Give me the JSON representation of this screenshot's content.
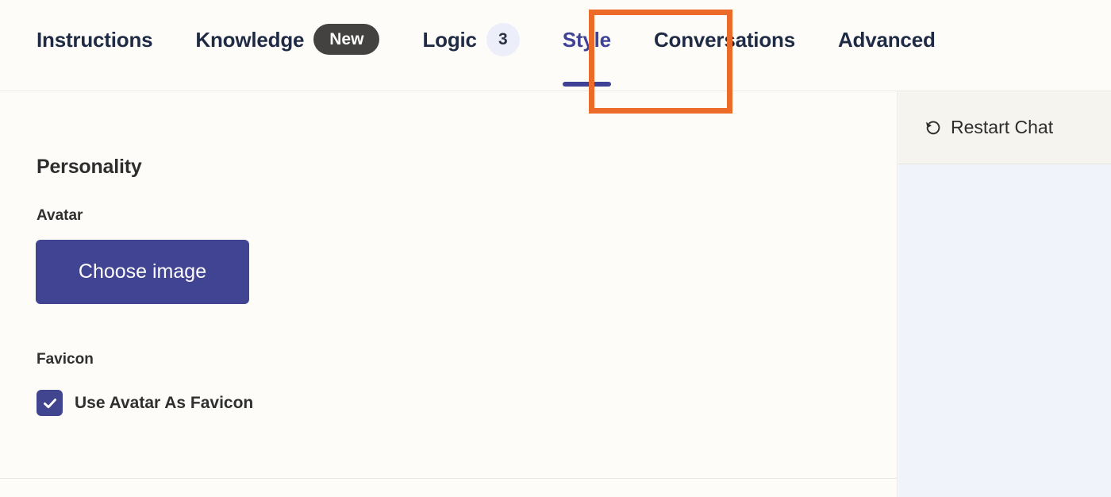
{
  "tabs": [
    {
      "label": "Instructions",
      "active": false,
      "badge": null,
      "badge_type": null
    },
    {
      "label": "Knowledge",
      "active": false,
      "badge": "New",
      "badge_type": "new"
    },
    {
      "label": "Logic",
      "active": false,
      "badge": "3",
      "badge_type": "count"
    },
    {
      "label": "Style",
      "active": true,
      "badge": null,
      "badge_type": null
    },
    {
      "label": "Conversations",
      "active": false,
      "badge": null,
      "badge_type": null
    },
    {
      "label": "Advanced",
      "active": false,
      "badge": null,
      "badge_type": null
    }
  ],
  "highlight": {
    "target_tab": "Style",
    "color": "#ed6b28"
  },
  "main": {
    "section_title": "Personality",
    "avatar": {
      "label": "Avatar",
      "button_label": "Choose image"
    },
    "favicon": {
      "label": "Favicon",
      "checkbox_label": "Use Avatar As Favicon",
      "checked": true
    }
  },
  "preview": {
    "restart_label": "Restart Chat",
    "restart_icon": "restart-counterclockwise-arrow-icon"
  },
  "colors": {
    "accent_indigo": "#414493",
    "active_tab_text": "#3f4296",
    "tab_text": "#1f2a44",
    "highlight_orange": "#ed6b28",
    "badge_new_bg": "#434240",
    "badge_count_bg": "#eceefa",
    "page_bg": "#fdfcf8",
    "preview_bg": "#f1f3fa",
    "preview_header_bg": "#f5f4ef"
  }
}
